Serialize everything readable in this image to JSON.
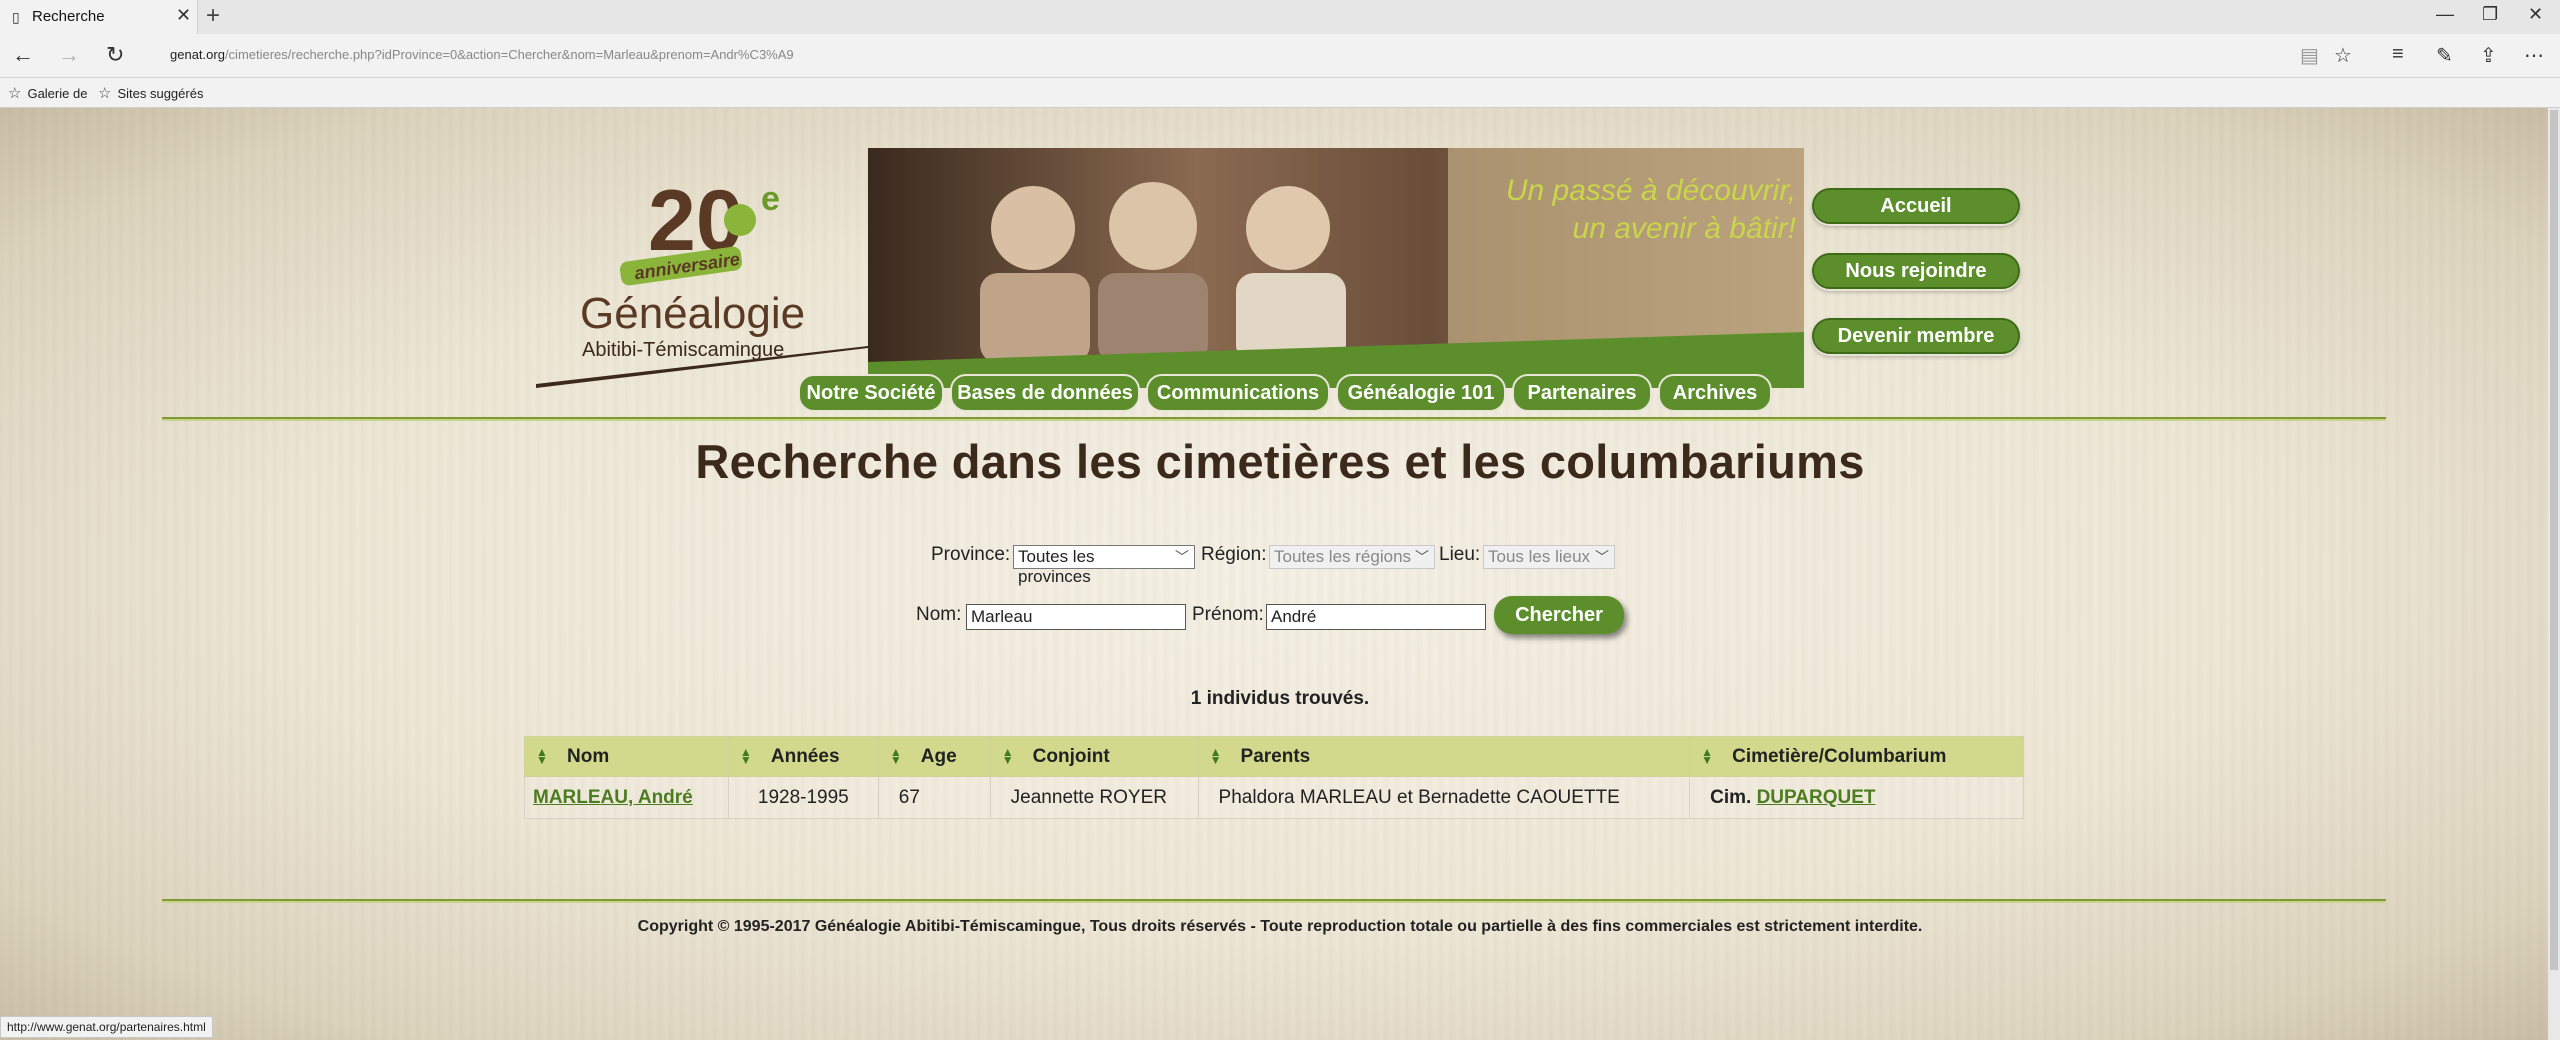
{
  "browser": {
    "tab_title": "Recherche",
    "tab_icon": "page-icon",
    "new_tab": "+",
    "url_domain": "genat.org",
    "url_path": "/cimetieres/recherche.php?idProvince=0&action=Chercher&nom=Marleau&prenom=Andr%C3%A9",
    "favorites": [
      "Galerie de",
      "Sites suggérés"
    ],
    "status_url": "http://www.genat.org/partenaires.html"
  },
  "header": {
    "logo_number": "20",
    "logo_sup": "e",
    "logo_ribbon": "anniversaire",
    "logo_title": "Généalogie",
    "logo_subtitle": "Abitibi-Témiscamingue",
    "banner_line1": "Un passé à découvrir,",
    "banner_line2": "un avenir à bâtir!",
    "side_buttons": [
      "Accueil",
      "Nous rejoindre",
      "Devenir membre"
    ],
    "menu": [
      "Notre Société",
      "Bases de données",
      "Communications",
      "Généalogie 101",
      "Partenaires",
      "Archives"
    ]
  },
  "main": {
    "title": "Recherche dans les cimetières et les columbariums",
    "province_label": "Province:",
    "province_value": "Toutes les provinces",
    "region_label": "Région:",
    "region_value": "Toutes les régions",
    "lieu_label": "Lieu:",
    "lieu_value": "Tous les lieux",
    "nom_label": "Nom:",
    "nom_value": "Marleau",
    "prenom_label": "Prénom:",
    "prenom_value": "André",
    "search_button": "Chercher",
    "result_count": "1 individus trouvés."
  },
  "table": {
    "headers": [
      "Nom",
      "Années",
      "Age",
      "Conjoint",
      "Parents",
      "Cimetière/Columbarium"
    ],
    "rows": [
      {
        "nom": "MARLEAU, André",
        "annees": "1928-1995",
        "age": "67",
        "conjoint": "Jeannette ROYER",
        "parents": "Phaldora MARLEAU et Bernadette CAOUETTE",
        "cim_prefix": "Cim.",
        "cim_name": "DUPARQUET"
      }
    ]
  },
  "footer": {
    "copyright": "Copyright © 1995-2017 Généalogie Abitibi-Témiscamingue, Tous droits réservés - Toute reproduction totale ou partielle à des fins commerciales est strictement interdite."
  },
  "colors": {
    "accent_green": "#5c8f2b",
    "title_brown": "#3b2a1c",
    "header_row": "#d3d98c"
  }
}
